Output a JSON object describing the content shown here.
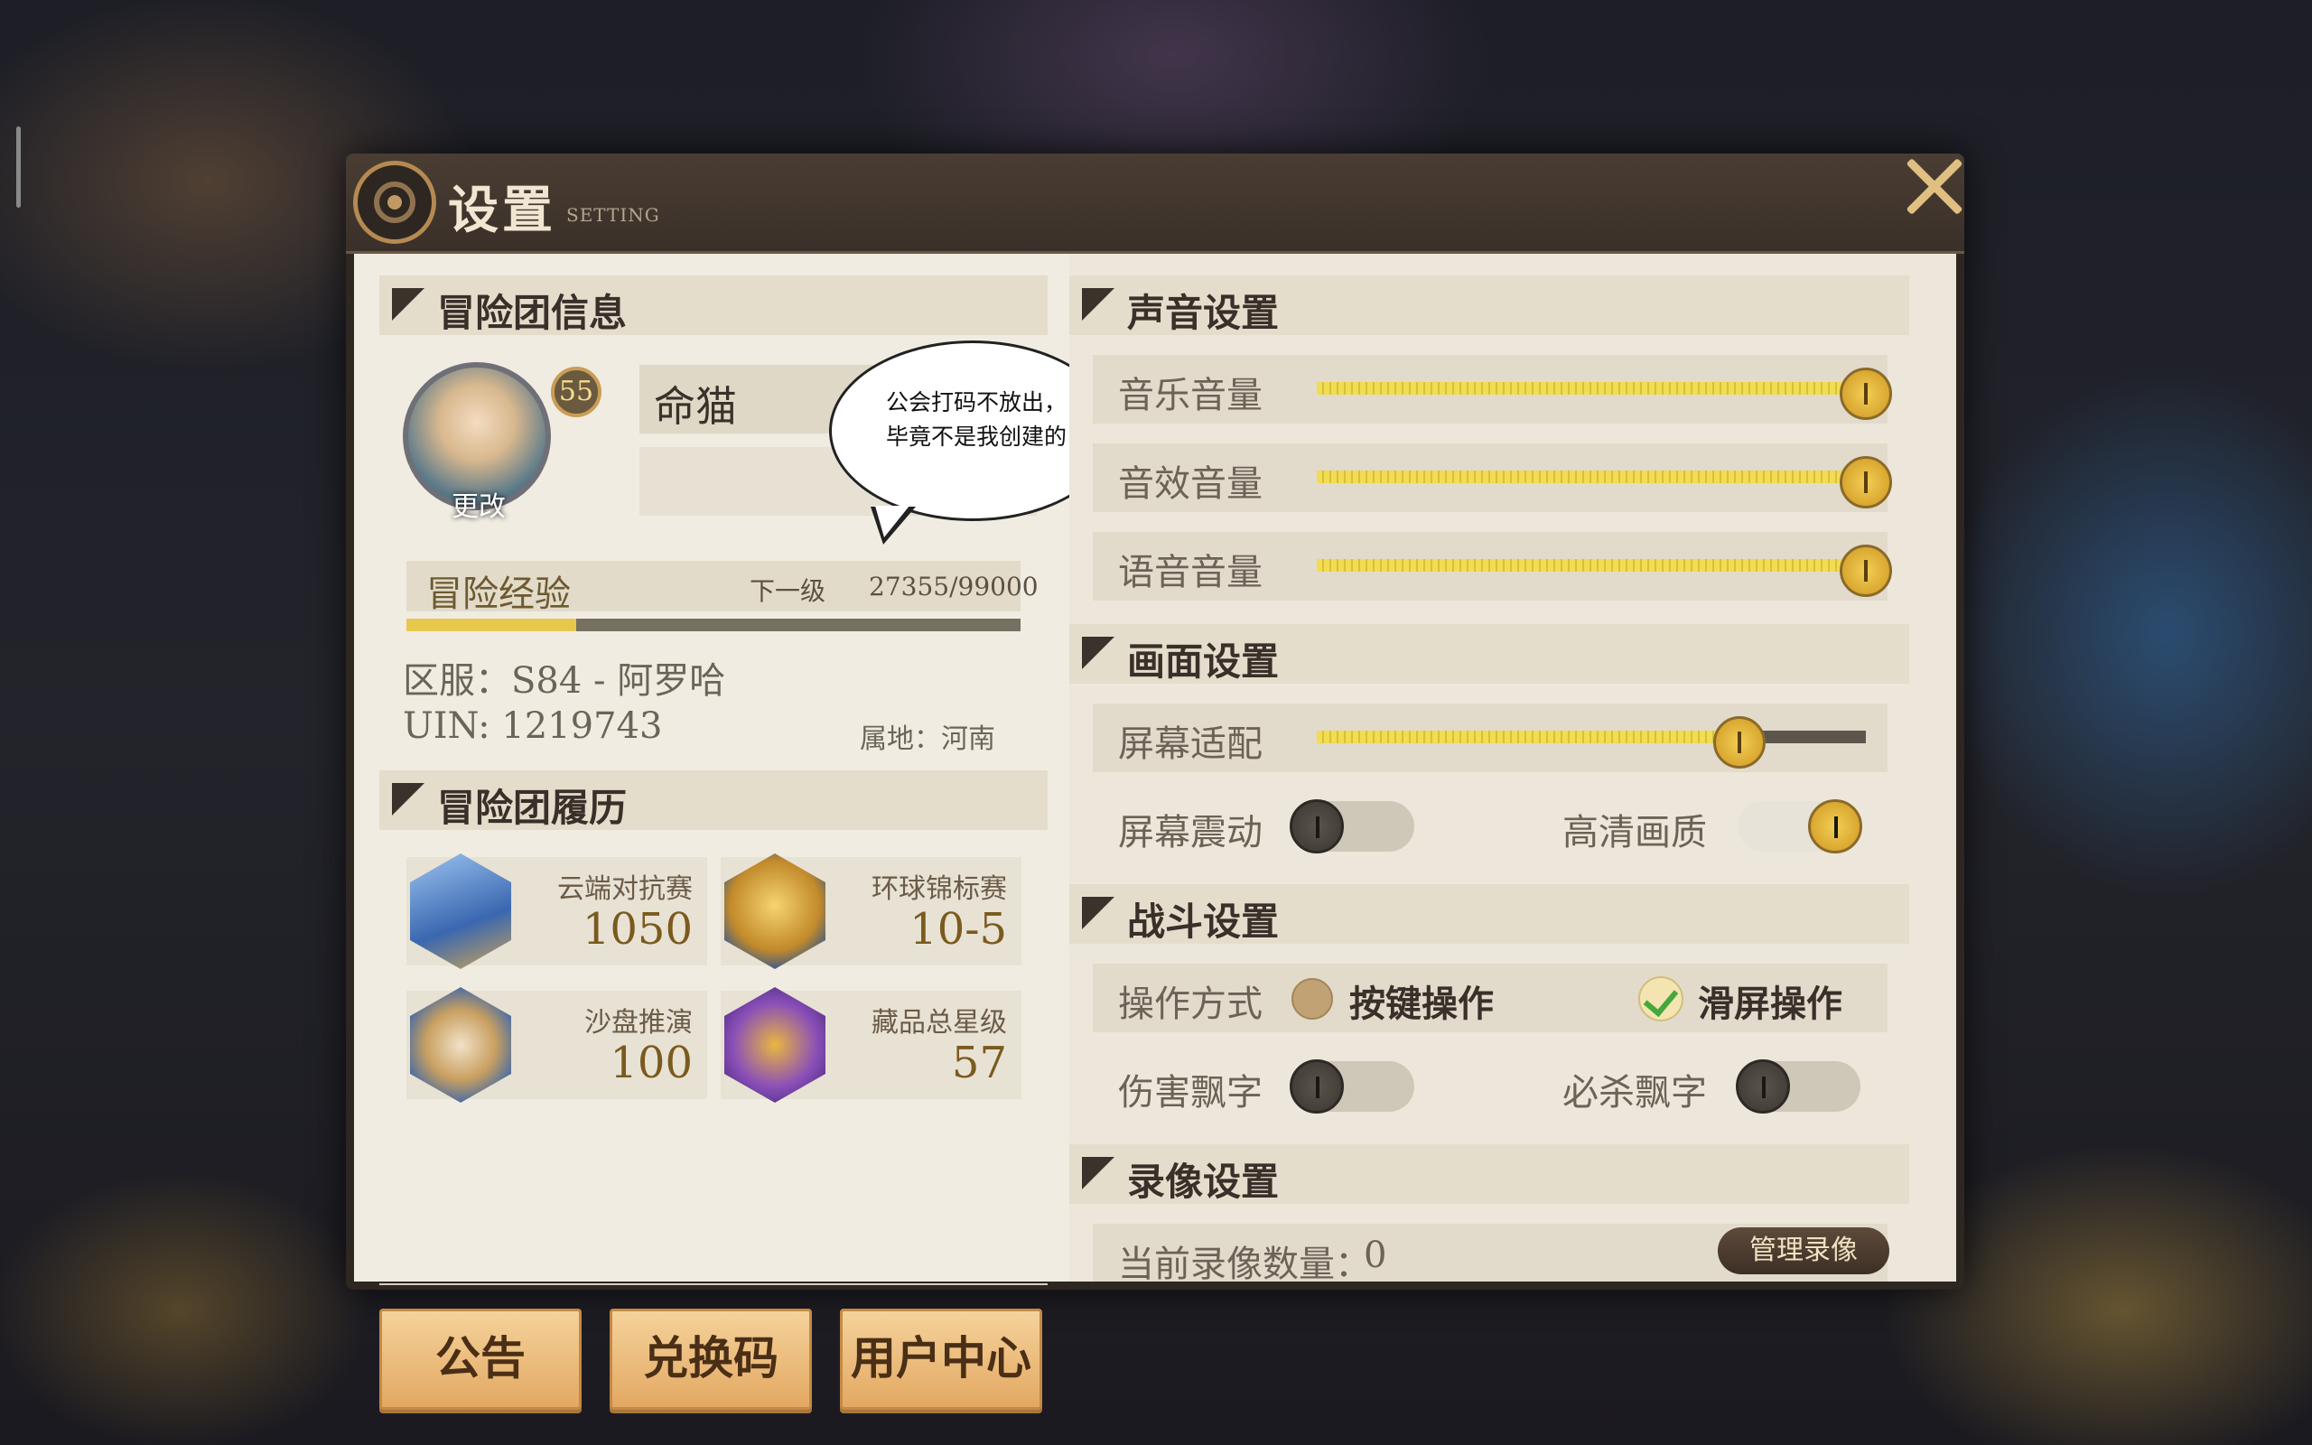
{
  "window": {
    "title": "设置",
    "subtitle": "SETTING"
  },
  "profile": {
    "section_title": "冒险团信息",
    "name": "命猫",
    "level": "55",
    "avatar_change": "更改",
    "exp_label": "冒险经验",
    "exp_next_label": "下一级",
    "exp_value": "27355/99000",
    "exp_progress": 0.276,
    "server": "区服：S84 - 阿罗哈",
    "uin": "UIN:  1219743",
    "region": "属地：河南"
  },
  "bubble": {
    "line1": "公会打码不放出，",
    "line2": "毕竟不是我创建的"
  },
  "history": {
    "section_title": "冒险团履历",
    "items": [
      {
        "label": "云端对抗赛",
        "value": "1050",
        "icon": "blue-diamond-medal-icon",
        "color": "#5b8ad0"
      },
      {
        "label": "环球锦标赛",
        "value": "10-5",
        "icon": "golden-globe-icon",
        "color": "#d3a23a"
      },
      {
        "label": "沙盘推演",
        "value": "100",
        "icon": "airship-icon",
        "color": "#4a78b8"
      },
      {
        "label": "藏品总星级",
        "value": "57",
        "icon": "trophy-statue-icon",
        "color": "#7b4ab0"
      }
    ]
  },
  "buttons": {
    "notice": "公告",
    "redeem": "兑换码",
    "user_center": "用户中心"
  },
  "sound": {
    "section_title": "声音设置",
    "music": {
      "label": "音乐音量",
      "value": 1.0
    },
    "sfx": {
      "label": "音效音量",
      "value": 1.0
    },
    "voice": {
      "label": "语音音量",
      "value": 1.0
    }
  },
  "display": {
    "section_title": "画面设置",
    "screen_fit": {
      "label": "屏幕适配",
      "value": 0.77
    },
    "shake": {
      "label": "屏幕震动",
      "on": false
    },
    "hd": {
      "label": "高清画质",
      "on": true
    }
  },
  "battle": {
    "section_title": "战斗设置",
    "control_label": "操作方式",
    "control_key": "按键操作",
    "control_swipe": "滑屏操作",
    "control_selected": "滑屏操作",
    "damage_text": {
      "label": "伤害飘字",
      "on": false
    },
    "kill_text": {
      "label": "必杀飘字",
      "on": false
    }
  },
  "recording": {
    "section_title": "录像设置",
    "count_label": "当前录像数量：",
    "count": "0",
    "manage": "管理录像"
  }
}
